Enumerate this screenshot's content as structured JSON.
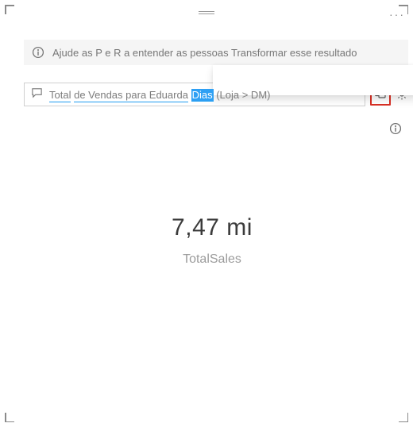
{
  "banner": {
    "text": "Ajude as P e R a entender as pessoas Transformar esse resultado"
  },
  "query": {
    "prefix": "Total",
    "mid": "de Vendas para Eduarda",
    "selected": "Dias",
    "suffix": "(Loja > DM)"
  },
  "card": {
    "value": "7,47 mi",
    "label": "TotalSales"
  },
  "icons": {
    "info": "info-icon",
    "chat": "chat-icon",
    "pin": "pin-visual-icon",
    "gear": "gear-icon",
    "more": "more-icon",
    "visual_info": "info-icon"
  }
}
